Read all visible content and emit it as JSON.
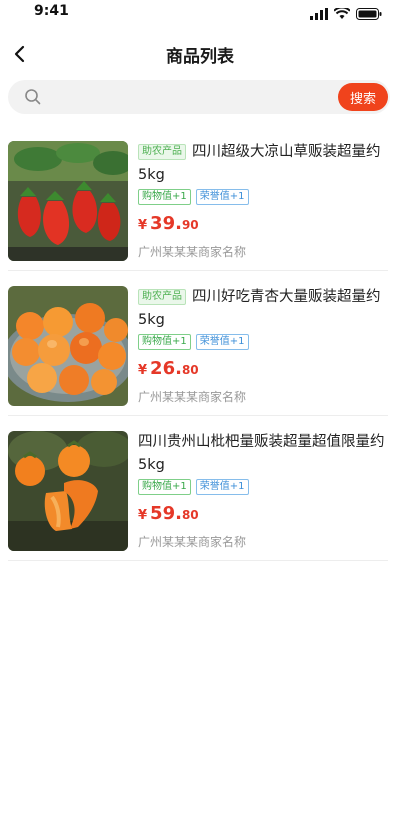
{
  "status": {
    "time": "9:41"
  },
  "header": {
    "title": "商品列表"
  },
  "search": {
    "placeholder": "",
    "button_label": "搜索"
  },
  "products": [
    {
      "badge": "助农产品",
      "title": "四川超级大凉山草贩装超量约5kg",
      "tags": [
        "购物值+1",
        "荣誉值+1"
      ],
      "price_int": "39.",
      "price_dec": "90",
      "currency": "¥",
      "merchant": "广州某某某商家名称",
      "image": "strawberries-image"
    },
    {
      "badge": "助农产品",
      "title": "四川好吃青杏大量贩装超量约5kg",
      "tags": [
        "购物值+1",
        "荣誉值+1"
      ],
      "price_int": "26.",
      "price_dec": "80",
      "currency": "¥",
      "merchant": "广州某某某商家名称",
      "image": "apricots-image"
    },
    {
      "badge": "",
      "title": "四川贵州山枇杷量贩装超量超值限量约5kg",
      "tags": [
        "购物值+1",
        "荣誉值+1"
      ],
      "price_int": "59.",
      "price_dec": "80",
      "currency": "¥",
      "merchant": "广州某某某商家名称",
      "image": "persimmon-image"
    }
  ],
  "colors": {
    "accent": "#f0431c",
    "price": "#e53828",
    "tag_green": "#39a84a",
    "tag_blue": "#3d8fd8"
  }
}
